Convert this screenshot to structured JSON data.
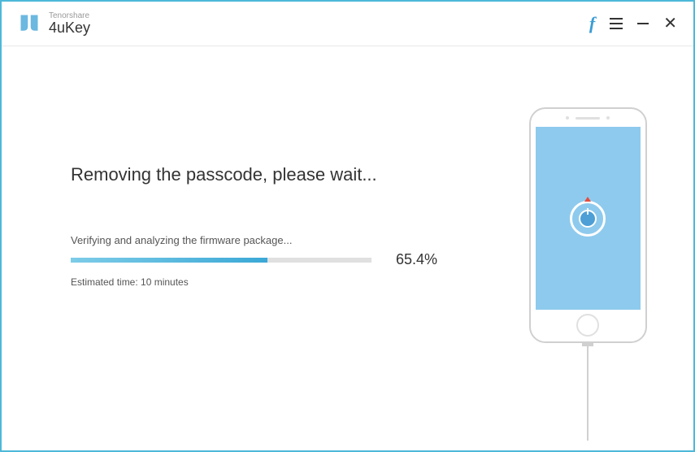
{
  "header": {
    "company": "Tenorshare",
    "product": "4uKey"
  },
  "main": {
    "heading": "Removing the passcode, please wait...",
    "status": "Verifying and analyzing the firmware package...",
    "percent": "65.4%",
    "progress_value": 65.4,
    "estimated": "Estimated time: 10 minutes"
  }
}
